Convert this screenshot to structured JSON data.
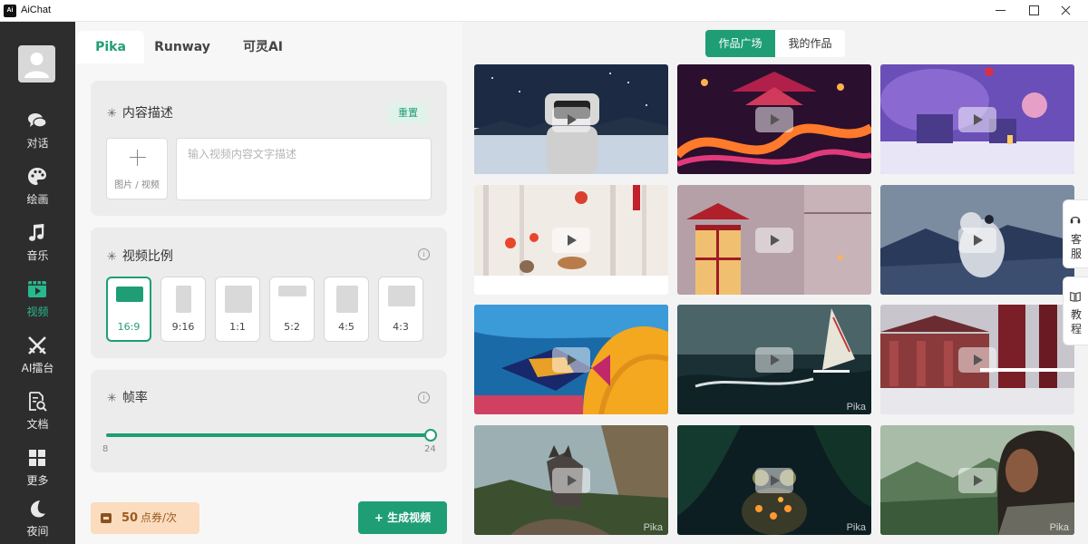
{
  "window": {
    "title": "AiChat",
    "logo_text": "Ai"
  },
  "sidebar": {
    "items": [
      {
        "label": "对话",
        "icon": "chat-bubbles-icon"
      },
      {
        "label": "绘画",
        "icon": "palette-icon"
      },
      {
        "label": "音乐",
        "icon": "music-note-icon"
      },
      {
        "label": "视频",
        "icon": "video-icon",
        "active": true
      },
      {
        "label": "AI擂台",
        "icon": "crossed-swords-icon"
      },
      {
        "label": "文档",
        "icon": "document-search-icon"
      },
      {
        "label": "更多",
        "icon": "grid-icon"
      },
      {
        "label": "夜间",
        "icon": "moon-icon"
      }
    ]
  },
  "tabs": [
    {
      "label": "Pika",
      "active": true
    },
    {
      "label": "Runway"
    },
    {
      "label": "可灵AI"
    }
  ],
  "content_desc": {
    "title": "内容描述",
    "reset_label": "重置",
    "upload_label": "图片 / 视频",
    "placeholder": "输入视频内容文字描述"
  },
  "aspect_ratio": {
    "title": "视频比例",
    "options": [
      "16:9",
      "9:16",
      "1:1",
      "5:2",
      "4:5",
      "4:3"
    ],
    "selected": "16:9"
  },
  "frame_rate": {
    "title": "帧率",
    "min": "8",
    "max": "24",
    "value": 24
  },
  "footer": {
    "cost_value": "50",
    "cost_unit": "点券/次",
    "generate_label": "+ 生成视频"
  },
  "gallery": {
    "segments": [
      "作品广场",
      "我的作品"
    ],
    "active_segment": "作品广场",
    "watermark": "Pika",
    "items": [
      {
        "name": "robot-snow"
      },
      {
        "name": "neon-dragon"
      },
      {
        "name": "purple-snow-village"
      },
      {
        "name": "snowy-lanterns-deer"
      },
      {
        "name": "red-lantern"
      },
      {
        "name": "polar-bear"
      },
      {
        "name": "coral-fish"
      },
      {
        "name": "windsurfer"
      },
      {
        "name": "snowy-palace"
      },
      {
        "name": "wolf-cliff"
      },
      {
        "name": "glowing-frog"
      },
      {
        "name": "warrior-woman"
      }
    ]
  },
  "side_tools": [
    {
      "label": "客服",
      "icon": "headset-icon"
    },
    {
      "label": "教程",
      "icon": "book-icon"
    }
  ],
  "colors": {
    "accent": "#1f9e76",
    "sidebar_bg": "#2d2d2d",
    "cost_bg": "#fbdcbf"
  }
}
